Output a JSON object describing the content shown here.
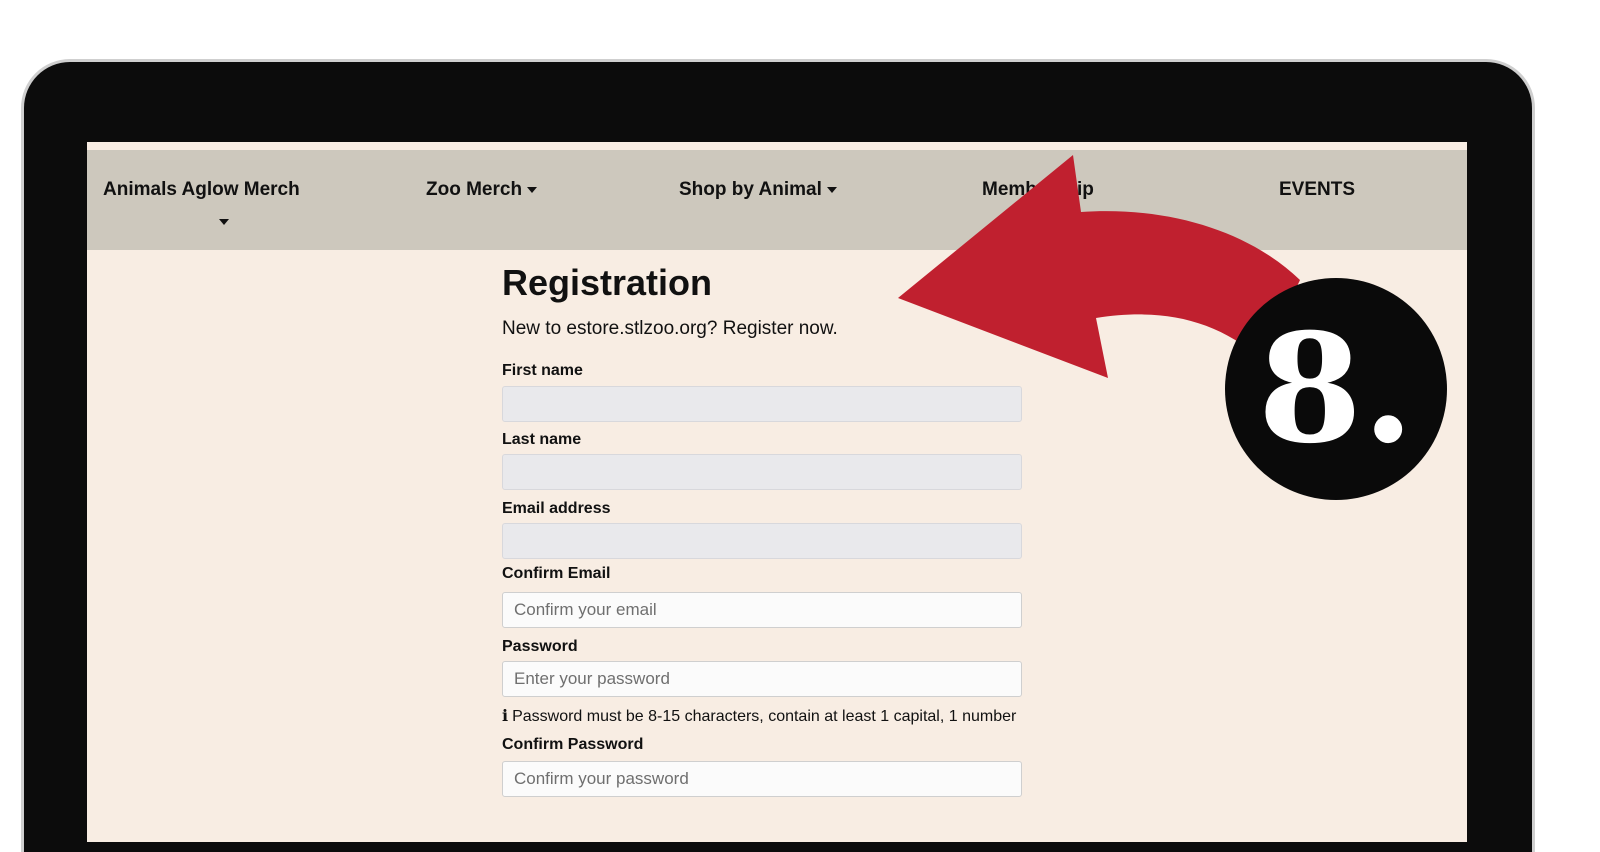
{
  "nav": {
    "items": [
      {
        "label": "Animals Aglow Merch"
      },
      {
        "label": "Zoo Merch"
      },
      {
        "label": "Shop by Animal"
      },
      {
        "label": "Membership"
      },
      {
        "label": "EVENTS"
      }
    ]
  },
  "form": {
    "title": "Registration",
    "subtitle": "New to estore.stlzoo.org? Register now.",
    "first_name": {
      "label": "First name",
      "value": "",
      "placeholder": ""
    },
    "last_name": {
      "label": "Last name",
      "value": "",
      "placeholder": ""
    },
    "email": {
      "label": "Email address",
      "value": "",
      "placeholder": ""
    },
    "confirm_email": {
      "label": "Confirm Email",
      "placeholder": "Confirm your email"
    },
    "password": {
      "label": "Password",
      "placeholder": "Enter your password"
    },
    "password_hint": "Password must be 8-15 characters, contain at least 1 capital, 1 number",
    "confirm_password": {
      "label": "Confirm Password",
      "placeholder": "Confirm your password"
    }
  },
  "annotation": {
    "step_number": "8.",
    "arrow_color": "#c0202f",
    "badge_color": "#0a0a0a"
  },
  "icons": {
    "info": "info-icon",
    "dropdown": "caret-down-icon"
  }
}
